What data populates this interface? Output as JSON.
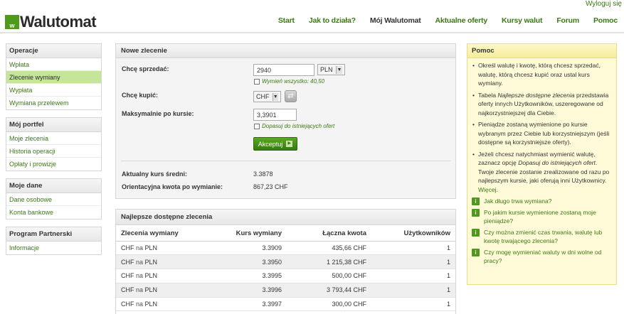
{
  "top": {
    "logout": "Wyloguj się"
  },
  "header": {
    "logo_badge": "w",
    "logo_text": "Walutomat",
    "nav": [
      "Start",
      "Jak to działa?",
      "Mój Walutomat",
      "Aktualne oferty",
      "Kursy walut",
      "Forum",
      "Pomoc"
    ],
    "active_nav": "Mój Walutomat"
  },
  "sidebar": {
    "operacje": {
      "title": "Operacje",
      "items": [
        "Wpłata",
        "Zlecenie wymiany",
        "Wypłata",
        "Wymiana przelewem"
      ],
      "active": "Zlecenie wymiany"
    },
    "portfel": {
      "title": "Mój portfel",
      "items": [
        "Moje zlecenia",
        "Historia operacji",
        "Opłaty i prowizje"
      ]
    },
    "dane": {
      "title": "Moje dane",
      "items": [
        "Dane osobowe",
        "Konta bankowe"
      ]
    },
    "partner": {
      "title": "Program Partnerski",
      "items": [
        "Informacje"
      ]
    }
  },
  "order": {
    "title": "Nowe zlecenie",
    "sell_label": "Chcę sprzedać:",
    "sell_amount": "2940",
    "sell_currency": "PLN",
    "exchange_all": "Wymień wszystko: 40,50",
    "buy_label": "Chcę kupić:",
    "buy_currency": "CHF",
    "max_rate_label": "Maksymalnie po kursie:",
    "max_rate": "3,3901",
    "match_existing": "Dopasuj do istniejących ofert",
    "accept_label": "Akceptuj",
    "avg_rate_label": "Aktualny kurs średni:",
    "avg_rate": "3.3878",
    "est_amount_label": "Orientacyjna kwota po wymianie:",
    "est_amount": "867,23 CHF"
  },
  "offers": {
    "title": "Najlepsze dostępne zlecenia",
    "headers": [
      "Zlecenia wymiany",
      "Kurs wymiany",
      "Łączna kwota",
      "Użytkowników"
    ],
    "rows": [
      {
        "from": "CHF",
        "na": "na",
        "to": "PLN",
        "rate": "3.3909",
        "amount": "435,66 CHF",
        "users": "1"
      },
      {
        "from": "CHF",
        "na": "na",
        "to": "PLN",
        "rate": "3.3950",
        "amount": "1 215,38 CHF",
        "users": "1"
      },
      {
        "from": "CHF",
        "na": "na",
        "to": "PLN",
        "rate": "3.3995",
        "amount": "500,00 CHF",
        "users": "1"
      },
      {
        "from": "CHF",
        "na": "na",
        "to": "PLN",
        "rate": "3.3996",
        "amount": "3 793,44 CHF",
        "users": "1"
      },
      {
        "from": "CHF",
        "na": "na",
        "to": "PLN",
        "rate": "3.3997",
        "amount": "300,00 CHF",
        "users": "1"
      }
    ]
  },
  "help": {
    "title": "Pomoc",
    "bullets": [
      {
        "before": "Określ walutę i kwotę, którą chcesz sprzedać, walutę, którą chcesz kupić oraz ustal kurs wymiany.",
        "em": "",
        "after": "",
        "link": ""
      },
      {
        "before": "Tabela ",
        "em": "Najlepsze dostępne zlecenia",
        "after": " przedstawia oferty innych Użytkowników, uszeregowane od najkorzystniejszej dla Ciebie.",
        "link": ""
      },
      {
        "before": "Pieniądze zostaną wymienione po kursie wybranym przez Ciebie lub korzystniejszym (jeśli dostępne są korzystniejsze oferty).",
        "em": "",
        "after": "",
        "link": ""
      },
      {
        "before": "Jeżeli chcesz natychmiast wymienić walutę, zaznacz opcję ",
        "em": "Dopasuj do istniejących ofert",
        "after": ". Twoje zlecenie zostanie zrealizowane od razu po najlepszym kursie, jaki oferują inni Użytkownicy. ",
        "link": "Więcej."
      }
    ],
    "faq": [
      "Jak długo trwa wymiana?",
      "Po jakim kursie wymienione zostaną moje pieniądze?",
      "Czy można zmienić czas trwania, walutę lub kwotę trwającego zlecenia?",
      "Czy mogę wymieniać waluty w dni wolne od pracy?"
    ]
  }
}
